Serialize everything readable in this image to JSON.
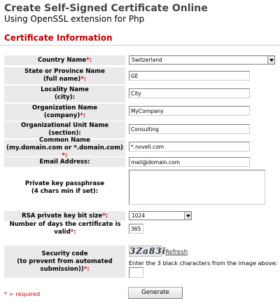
{
  "header": {
    "title": "Create Self-Signed Certificate Online",
    "subtitle": "Using OpenSSL extension for Php"
  },
  "section_title": "Certificate Information",
  "form": {
    "country": {
      "label": "Country Name",
      "required_mark": "*:",
      "value": "Switzerland"
    },
    "state": {
      "label_line1": "State or Province Name",
      "label_line2": "(full name)",
      "required_mark": "*:",
      "value": "GE"
    },
    "locality": {
      "label_line1": "Locality Name",
      "label_line2": "(city):",
      "value": "City"
    },
    "organization": {
      "label_line1": "Organization Name",
      "label_line2": "(company)",
      "required_mark": "*:",
      "value": "MyCompany"
    },
    "org_unit": {
      "label_line1": "Organizational Unit Name",
      "label_line2": "(section):",
      "value": "Consulting"
    },
    "common_name": {
      "label_line1": "Common Name",
      "label_line2": "(my.domain.com or *.domain.com)",
      "required_mark": "*:",
      "value": "*.novell.com"
    },
    "email": {
      "label": "Email Address:",
      "value": "mail@domain.com"
    },
    "passphrase": {
      "label_line1": "Private key passphrase",
      "label_line2": "(4 chars min if set):",
      "value": ""
    },
    "key_size": {
      "label": "RSA private key bit size",
      "required_mark": "*:",
      "value": "1024"
    },
    "days_valid": {
      "label": "Number of days the certificate is valid",
      "required_mark": "*:",
      "value": "365"
    },
    "security": {
      "label_line1": "Security code",
      "label_line2": "(to prevent from automated",
      "label_line3": "submission))",
      "required_mark": "*:",
      "captcha_text": "3Za83i",
      "refresh_label": "Refresh",
      "hint": "Enter the 3 black characters from the image above:",
      "value": ""
    }
  },
  "footer": {
    "required_legend": "* = required",
    "generate_label": "Generate"
  }
}
